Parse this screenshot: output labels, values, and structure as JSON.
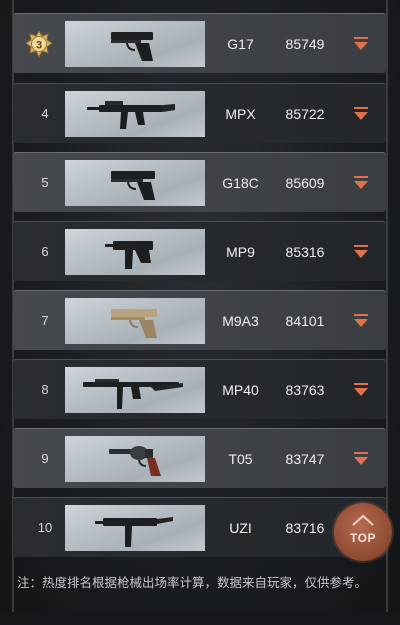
{
  "colors": {
    "accent_arrow": "#e0724a",
    "top_button": "#9a5238",
    "medal_gold": "#d8b56a"
  },
  "rankings": [
    {
      "rank": "3",
      "rank_icon": "medal-3-icon",
      "name": "G17",
      "score": "85749",
      "gun_icon": "pistol-icon"
    },
    {
      "rank": "4",
      "name": "MPX",
      "score": "85722",
      "gun_icon": "smg-icon"
    },
    {
      "rank": "5",
      "name": "G18C",
      "score": "85609",
      "gun_icon": "pistol-icon"
    },
    {
      "rank": "6",
      "name": "MP9",
      "score": "85316",
      "gun_icon": "machine-pistol-icon"
    },
    {
      "rank": "7",
      "name": "M9A3",
      "score": "84101",
      "gun_icon": "pistol-tan-icon"
    },
    {
      "rank": "8",
      "name": "MP40",
      "score": "83763",
      "gun_icon": "smg-long-icon"
    },
    {
      "rank": "9",
      "name": "T05",
      "score": "83747",
      "gun_icon": "revolver-icon"
    },
    {
      "rank": "10",
      "name": "UZI",
      "score": "83716",
      "gun_icon": "smg-compact-icon"
    }
  ],
  "footer_note": "注：热度排名根据枪械出场率计算，数据来自玩家，仅供参考。",
  "top_button_label": "TOP"
}
